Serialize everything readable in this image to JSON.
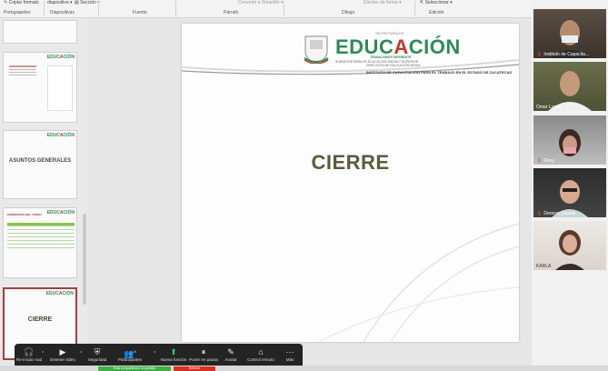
{
  "ribbon": {
    "copy_format": "Copiar formato",
    "slide_label": "diapositiva",
    "section": "Sección",
    "convert_smartart": "Convertir a SmartArt",
    "shape_effects": "Efectos de forma",
    "select": "Seleccionar",
    "groups": [
      "Portapapeles",
      "Diapositivas",
      "Fuente",
      "Párrafo",
      "Dibujo",
      "Edición"
    ]
  },
  "thumbnails": [
    {
      "title": ""
    },
    {
      "title": ""
    },
    {
      "title": "ASUNTOS GENERALES"
    },
    {
      "title": "PENDIENTES DEL CURSO"
    },
    {
      "title": "CIERRE"
    }
  ],
  "slide": {
    "title": "CIERRE",
    "brand": {
      "word_start": "EDUC",
      "word_accent": "A",
      "word_end": "CIÓN",
      "above": "SECRETARÍA DE",
      "tagline": "TRABAJAMOS DIFERENTE",
      "sub1": "SUBSECRETARÍA DE EDUCACIÓN MEDIA Y SUPERIOR",
      "sub2": "DIRECCIÓN DE EDUCACIÓN MEDIA",
      "institute": "INSTITUTO DE CAPACITACIÓN PARA EL TRABAJO EN EL ESTADO DE ZACATECAS"
    }
  },
  "participants": [
    {
      "name": "Instituto de Capacita..."
    },
    {
      "name": "Omar Lopez"
    },
    {
      "name": "Rosy"
    },
    {
      "name": "Denese Salazar"
    },
    {
      "name": "KARLA"
    }
  ],
  "toolbar": {
    "items": [
      {
        "label": "Re-iniciar Aud",
        "icon": "headphones-icon"
      },
      {
        "label": "Detener video",
        "icon": "video-icon"
      },
      {
        "label": "Seguridad",
        "icon": "shield-icon"
      },
      {
        "label": "Participantes",
        "icon": "participants-icon",
        "count": "5"
      },
      {
        "label": "Nueva función",
        "icon": "share-icon"
      },
      {
        "label": "Poner en pausa",
        "icon": "pause-icon"
      },
      {
        "label": "Anotar",
        "icon": "pen-icon"
      },
      {
        "label": "Control remoto",
        "icon": "mouse-icon"
      },
      {
        "label": "Más",
        "icon": "more-icon"
      }
    ]
  },
  "status": {
    "sharing": "Está compartiendo la pantalla",
    "stop": "Detener"
  },
  "colors": {
    "brand_green": "#2e8b57",
    "brand_red": "#c0392b",
    "title_olive": "#5c5a3c",
    "toolbar_bg": "#242424",
    "share_green": "#3cb043",
    "stop_red": "#d93025"
  }
}
